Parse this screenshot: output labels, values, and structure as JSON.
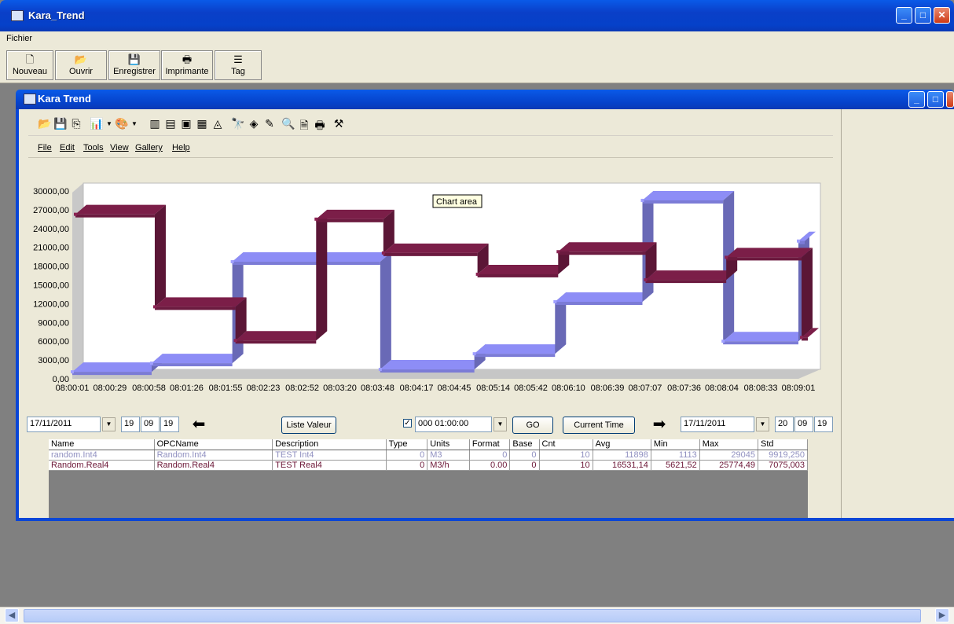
{
  "window": {
    "title": "Kara_Trend"
  },
  "menu": {
    "file": "Fichier"
  },
  "toolbar": [
    {
      "label": "Nouveau",
      "icon": "new-document-icon",
      "glyph": "🗋"
    },
    {
      "label": "Ouvrir",
      "icon": "open-folder-icon",
      "glyph": "📂"
    },
    {
      "label": "Enregistrer",
      "icon": "save-disk-icon",
      "glyph": "💾"
    },
    {
      "label": "Imprimante",
      "icon": "printer-icon",
      "glyph": "🖶"
    },
    {
      "label": "Tag",
      "icon": "tag-list-icon",
      "glyph": "☰"
    }
  ],
  "inner_window": {
    "title": "Kara Trend"
  },
  "chart_menu": [
    "File",
    "Edit",
    "Tools",
    "View",
    "Gallery",
    "Help"
  ],
  "chart_data": {
    "type": "line",
    "tooltip": "Chart area",
    "y_ticks": [
      "0,00",
      "3000,00",
      "6000,00",
      "9000,00",
      "12000,00",
      "15000,00",
      "18000,00",
      "21000,00",
      "24000,00",
      "27000,00",
      "30000,00"
    ],
    "ylim": [
      0,
      30000
    ],
    "x_ticks": [
      "08:00:01",
      "08:00:29",
      "08:00:58",
      "08:01:26",
      "08:01:55",
      "08:02:23",
      "08:02:52",
      "08:03:20",
      "08:03:48",
      "08:04:17",
      "08:04:45",
      "08:05:14",
      "08:05:42",
      "08:06:10",
      "08:06:39",
      "08:07:07",
      "08:07:36",
      "08:08:04",
      "08:08:33",
      "08:09:01"
    ],
    "step": true,
    "series": [
      {
        "name": "random.Int4",
        "color": "#7b7bd6",
        "x": [
          "08:00:01",
          "08:01:00",
          "08:02:00",
          "08:03:50",
          "08:05:00",
          "08:06:00",
          "08:07:05",
          "08:08:05",
          "08:09:01"
        ],
        "values": [
          1113,
          2500,
          18700,
          1500,
          4000,
          12300,
          28500,
          6000,
          22000
        ]
      },
      {
        "name": "Random.Real4",
        "color": "#6b1a3f",
        "x": [
          "08:00:01",
          "08:01:00",
          "08:02:00",
          "08:03:00",
          "08:03:50",
          "08:05:00",
          "08:06:00",
          "08:07:05",
          "08:08:05",
          "08:09:01"
        ],
        "values": [
          25774,
          11000,
          5621,
          25000,
          19600,
          16200,
          19800,
          15300,
          18900,
          6100
        ]
      }
    ]
  },
  "controls": {
    "start_date": "17/11/2011",
    "start_h": "19",
    "start_m": "09",
    "start_s": "19",
    "liste_valeur": "Liste Valeur",
    "interval": "000 01:00:00",
    "go": "GO",
    "current_time": "Current Time",
    "end_date": "17/11/2011",
    "end_h": "20",
    "end_m": "09",
    "end_s": "19"
  },
  "grid": {
    "columns": [
      "Name",
      "OPCName",
      "Description",
      "Type",
      "Units",
      "Format",
      "Base",
      "Cnt",
      "Avg",
      "Min",
      "Max",
      "Std"
    ],
    "rows": [
      [
        "random.Int4",
        "Random.Int4",
        "TEST Int4",
        "0",
        "M3",
        "0",
        "0",
        "10",
        "11898",
        "1113",
        "29045",
        "9919,250"
      ],
      [
        "Random.Real4",
        "Random.Real4",
        "TEST Real4",
        "0",
        "M3/h",
        "0.00",
        "0",
        "10",
        "16531,14",
        "5621,52",
        "25774,49",
        "7075,003"
      ]
    ]
  }
}
